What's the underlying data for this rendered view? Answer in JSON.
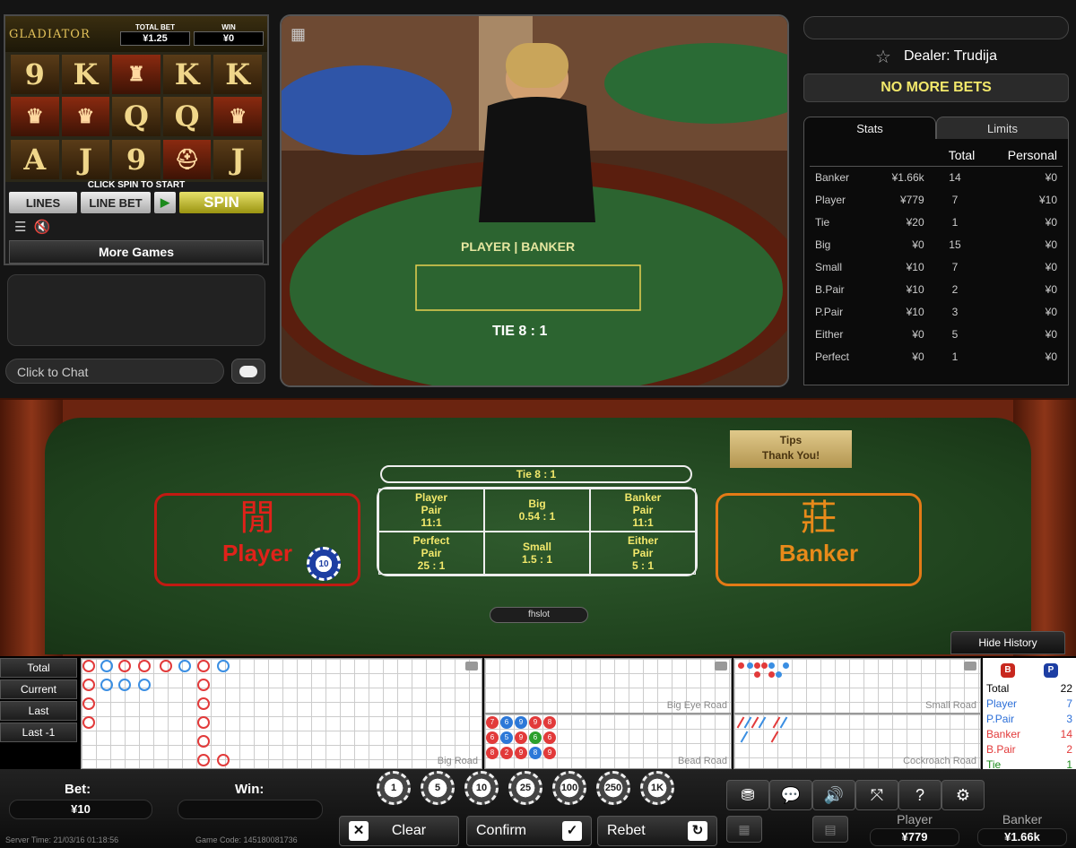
{
  "slot": {
    "logo": "GLADIATOR",
    "total_bet_label": "TOTAL BET",
    "total_bet": "¥1.25",
    "win_label": "WIN",
    "win": "¥0",
    "reels": [
      "9",
      "K",
      "♜",
      "K",
      "K",
      "♛",
      "♛",
      "Q",
      "Q",
      "♛",
      "A",
      "J",
      "9",
      "⛑",
      "J"
    ],
    "hint": "CLICK SPIN TO START",
    "lines_label": "LINES",
    "line_bet_label": "LINE BET",
    "spin_label": "SPIN",
    "more_games_label": "More Games"
  },
  "chat": {
    "placeholder": "Click to Chat"
  },
  "dealer": {
    "name": "Dealer: Trudija"
  },
  "status": "NO MORE BETS",
  "tabs": [
    "Stats",
    "Limits"
  ],
  "stats": {
    "headers": [
      "",
      "",
      "Total",
      "Personal"
    ],
    "rows": [
      [
        "Banker",
        "¥1.66k",
        "14",
        "¥0"
      ],
      [
        "Player",
        "¥779",
        "7",
        "¥10"
      ],
      [
        "Tie",
        "¥20",
        "1",
        "¥0"
      ],
      [
        "Big",
        "¥0",
        "15",
        "¥0"
      ],
      [
        "Small",
        "¥10",
        "7",
        "¥0"
      ],
      [
        "B.Pair",
        "¥10",
        "2",
        "¥0"
      ],
      [
        "P.Pair",
        "¥10",
        "3",
        "¥0"
      ],
      [
        "Either",
        "¥0",
        "5",
        "¥0"
      ],
      [
        "Perfect",
        "¥0",
        "1",
        "¥0"
      ]
    ]
  },
  "table": {
    "tips_label": "Tips",
    "tips_thanks": "Thank You!",
    "tie_label": "Tie 8 : 1",
    "side_bets": [
      [
        "Player",
        "Pair",
        "11:1"
      ],
      [
        "Big",
        "0.54 : 1",
        ""
      ],
      [
        "Banker",
        "Pair",
        "11:1"
      ],
      [
        "Perfect",
        "Pair",
        "25 : 1"
      ],
      [
        "Small",
        "1.5 : 1",
        ""
      ],
      [
        "Either",
        "Pair",
        "5 : 1"
      ]
    ],
    "player_han": "閒",
    "player_label": "Player",
    "banker_han": "莊",
    "banker_label": "Banker",
    "player_chip": "10",
    "username": "fhslot",
    "hide_history_label": "Hide History"
  },
  "history": {
    "buttons": [
      "Total",
      "Current",
      "Last",
      "Last -1"
    ],
    "roads": [
      "Big Road",
      "Big Eye Road",
      "Small Road",
      "Bead Road",
      "Cockroach Road"
    ],
    "summary_badges": [
      "B",
      "P"
    ],
    "summary": [
      [
        "Total",
        "22",
        "#000"
      ],
      [
        "Player",
        "7",
        "#2c6fd8"
      ],
      [
        "P.Pair",
        "3",
        "#2c6fd8"
      ],
      [
        "Banker",
        "14",
        "#e23a3a"
      ],
      [
        "B.Pair",
        "2",
        "#e23a3a"
      ],
      [
        "Tie",
        "1",
        "#1a8a1a"
      ]
    ]
  },
  "bottom": {
    "bet_label": "Bet:",
    "bet_value": "¥10",
    "win_label": "Win:",
    "win_value": "",
    "server_time": "Server Time: 21/03/16 01:18:56",
    "game_code": "Game Code: 145180081736",
    "chips": [
      "1",
      "5",
      "10",
      "25",
      "100",
      "250",
      "1K"
    ],
    "clear_label": "Clear",
    "confirm_label": "Confirm",
    "rebet_label": "Rebet",
    "player_total_label": "Player",
    "player_total": "¥779",
    "banker_total_label": "Banker",
    "banker_total": "¥1.66k"
  },
  "colors": {
    "accent_yellow": "#f2e86b",
    "player_red": "#e0221a",
    "banker_orange": "#e88a1a",
    "felt_green": "#1f421d"
  }
}
